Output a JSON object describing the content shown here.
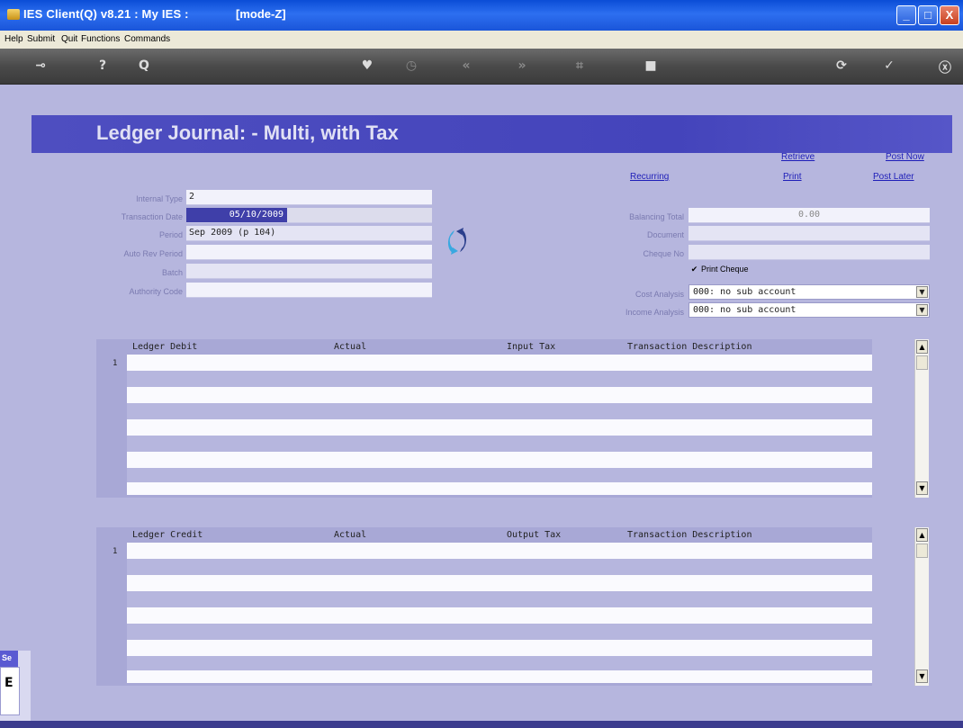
{
  "window": {
    "title": "IES Client(Q) v8.21 : My IES :",
    "mode": "[mode-Z]",
    "buttons": {
      "minimize": "_",
      "maximize": "□",
      "close": "X"
    }
  },
  "menu": [
    "Help",
    "Submit",
    "Quit",
    "Functions",
    "Commands"
  ],
  "toolbar": {
    "icons": [
      "key-icon",
      "help-icon",
      "search-icon",
      "heart-icon",
      "clock-icon",
      "first-icon",
      "last-icon",
      "tools-icon",
      "stop-icon",
      "refresh-icon",
      "ok-icon",
      "exit-icon"
    ],
    "glyphs": [
      "⊸",
      "?",
      "Q",
      "♥",
      "◷",
      "«",
      "»",
      "⌗",
      "■",
      "⟳",
      "✓",
      "ⓧ"
    ]
  },
  "page": {
    "title": "Ledger Journal: - Multi, with Tax"
  },
  "actions": {
    "retrieve": "Retrieve",
    "post_now": "Post Now",
    "recurring": "Recurring",
    "print": "Print",
    "post_later": "Post Later"
  },
  "form_left": {
    "internal_type": {
      "label": "Internal Type",
      "value": "2"
    },
    "transaction_date": {
      "label": "Transaction Date",
      "value": "05/10/2009"
    },
    "period": {
      "label": "Period",
      "value": "Sep 2009 (p 104)"
    },
    "auto_rev_period": {
      "label": "Auto Rev Period",
      "value": ""
    },
    "batch": {
      "label": "Batch",
      "value": ""
    },
    "authority_code": {
      "label": "Authority Code",
      "value": ""
    }
  },
  "form_right": {
    "balancing_total": {
      "label": "Balancing Total",
      "value": "0.00"
    },
    "document": {
      "label": "Document",
      "value": ""
    },
    "cheque_no": {
      "label": "Cheque No",
      "value": ""
    },
    "print_cheque": {
      "label": "Print Cheque",
      "checked": true,
      "mark": "✔"
    },
    "cost_analysis": {
      "label": "Cost Analysis",
      "value": "000: no sub account"
    },
    "income_analysis": {
      "label": "Income Analysis",
      "value": "000: no sub account"
    }
  },
  "debit_grid": {
    "columns": [
      "Ledger Debit",
      "Actual",
      "Input Tax",
      "Transaction Description"
    ],
    "row_number": "1"
  },
  "credit_grid": {
    "columns": [
      "Ledger Credit",
      "Actual",
      "Output Tax",
      "Transaction Description"
    ],
    "row_number": "1"
  },
  "scroll": {
    "up": "▲",
    "down": "▼"
  },
  "dropdown_arrow": "▼",
  "side_panel": {
    "head": "Se",
    "body": "E"
  }
}
